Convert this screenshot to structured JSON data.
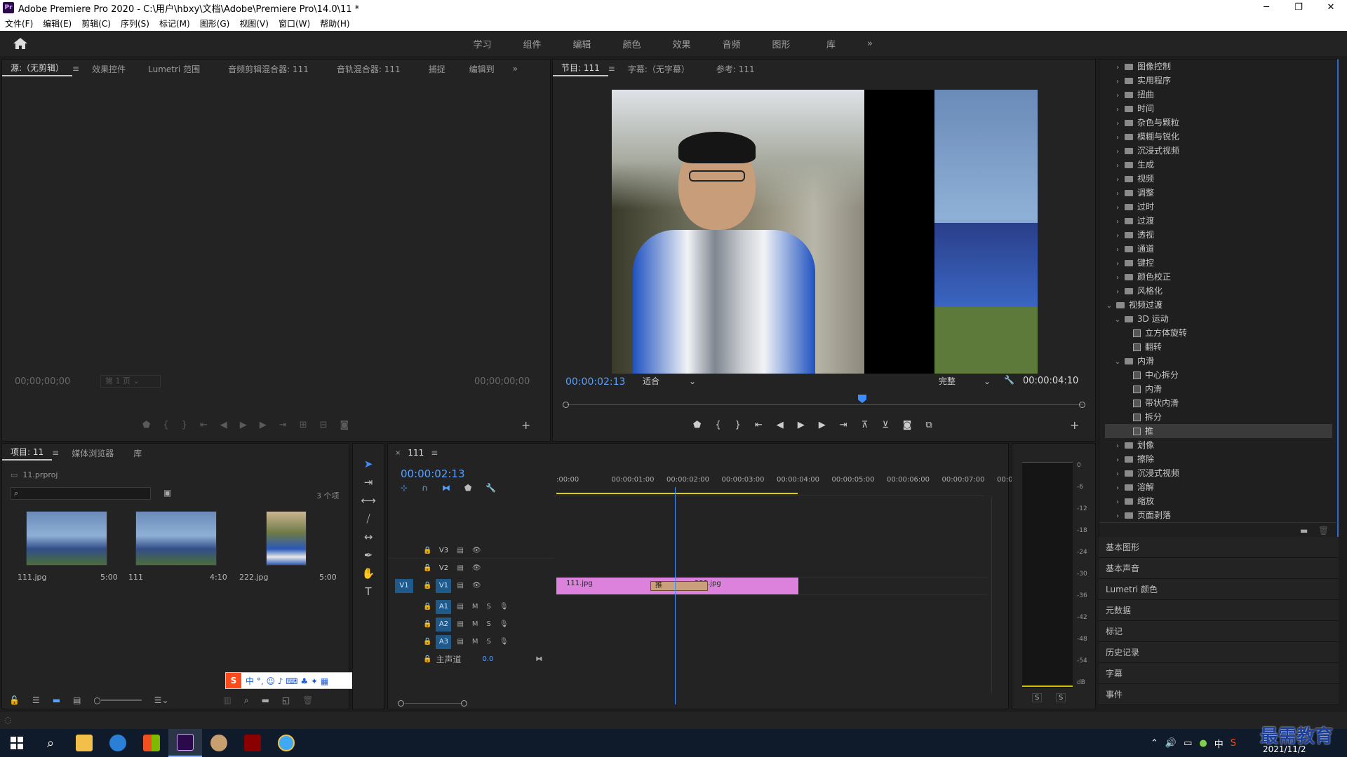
{
  "window": {
    "title": "Adobe Premiere Pro 2020 - C:\\用户\\hbxy\\文档\\Adobe\\Premiere Pro\\14.0\\11 *",
    "app_badge": "Pr"
  },
  "menu": [
    "文件(F)",
    "编辑(E)",
    "剪辑(C)",
    "序列(S)",
    "标记(M)",
    "图形(G)",
    "视图(V)",
    "窗口(W)",
    "帮助(H)"
  ],
  "workspaces": [
    "学习",
    "组件",
    "编辑",
    "颜色",
    "效果",
    "音频",
    "图形",
    "库"
  ],
  "source_panel": {
    "tabs": [
      "源:（无剪辑）",
      "效果控件",
      "Lumetri 范围",
      "音频剪辑混合器: 111",
      "音轨混合器: 111",
      "捕捉",
      "编辑到"
    ],
    "tc_in": "00;00;00;00",
    "tc_out": "00;00;00;00",
    "page_select": "第 1 页"
  },
  "program_panel": {
    "tabs": [
      "节目: 111",
      "字幕:（无字幕）",
      "参考: 111"
    ],
    "timecode": "00:00:02:13",
    "fit": "适合",
    "quality": "完整",
    "duration": "00:00:04:10"
  },
  "effects_tree": [
    {
      "type": "folder",
      "indent": 1,
      "label": "图像控制",
      "open": false
    },
    {
      "type": "folder",
      "indent": 1,
      "label": "实用程序",
      "open": false
    },
    {
      "type": "folder",
      "indent": 1,
      "label": "扭曲",
      "open": false
    },
    {
      "type": "folder",
      "indent": 1,
      "label": "时间",
      "open": false
    },
    {
      "type": "folder",
      "indent": 1,
      "label": "杂色与颗粒",
      "open": false
    },
    {
      "type": "folder",
      "indent": 1,
      "label": "模糊与锐化",
      "open": false
    },
    {
      "type": "folder",
      "indent": 1,
      "label": "沉浸式视频",
      "open": false
    },
    {
      "type": "folder",
      "indent": 1,
      "label": "生成",
      "open": false
    },
    {
      "type": "folder",
      "indent": 1,
      "label": "视频",
      "open": false
    },
    {
      "type": "folder",
      "indent": 1,
      "label": "调整",
      "open": false
    },
    {
      "type": "folder",
      "indent": 1,
      "label": "过时",
      "open": false
    },
    {
      "type": "folder",
      "indent": 1,
      "label": "过渡",
      "open": false
    },
    {
      "type": "folder",
      "indent": 1,
      "label": "透视",
      "open": false
    },
    {
      "type": "folder",
      "indent": 1,
      "label": "通道",
      "open": false
    },
    {
      "type": "folder",
      "indent": 1,
      "label": "键控",
      "open": false
    },
    {
      "type": "folder",
      "indent": 1,
      "label": "颜色校正",
      "open": false
    },
    {
      "type": "folder",
      "indent": 1,
      "label": "风格化",
      "open": false
    },
    {
      "type": "folder",
      "indent": 0,
      "label": "视频过渡",
      "open": true
    },
    {
      "type": "folder",
      "indent": 1,
      "label": "3D 运动",
      "open": true
    },
    {
      "type": "item",
      "indent": 2,
      "label": "立方体旋转"
    },
    {
      "type": "item",
      "indent": 2,
      "label": "翻转"
    },
    {
      "type": "folder",
      "indent": 1,
      "label": "内滑",
      "open": true
    },
    {
      "type": "item",
      "indent": 2,
      "label": "中心拆分"
    },
    {
      "type": "item",
      "indent": 2,
      "label": "内滑"
    },
    {
      "type": "item",
      "indent": 2,
      "label": "带状内滑"
    },
    {
      "type": "item",
      "indent": 2,
      "label": "拆分"
    },
    {
      "type": "item",
      "indent": 2,
      "label": "推",
      "selected": true
    },
    {
      "type": "folder",
      "indent": 1,
      "label": "划像",
      "open": false
    },
    {
      "type": "folder",
      "indent": 1,
      "label": "擦除",
      "open": false
    },
    {
      "type": "folder",
      "indent": 1,
      "label": "沉浸式视频",
      "open": false
    },
    {
      "type": "folder",
      "indent": 1,
      "label": "溶解",
      "open": false
    },
    {
      "type": "folder",
      "indent": 1,
      "label": "缩放",
      "open": false
    },
    {
      "type": "folder",
      "indent": 1,
      "label": "页面剥落",
      "open": false
    }
  ],
  "side_panels": [
    "基本图形",
    "基本声音",
    "Lumetri 颜色",
    "元数据",
    "标记",
    "历史记录",
    "字幕",
    "事件"
  ],
  "project_panel": {
    "tabs": [
      "项目: 11",
      "媒体浏览器",
      "库"
    ],
    "file": "11.prproj",
    "count": "3 个项",
    "items": [
      {
        "name": "111.jpg",
        "dur": "5:00"
      },
      {
        "name": "111",
        "dur": "4:10"
      },
      {
        "name": "222.jpg",
        "dur": "5:00"
      }
    ]
  },
  "timeline": {
    "tab": "111",
    "timecode": "00:00:02:13",
    "ruler": [
      ":00:00",
      "00:00:01:00",
      "00:00:02:00",
      "00:00:03:00",
      "00:00:04:00",
      "00:00:05:00",
      "00:00:06:00",
      "00:00:07:00",
      "00:00:0"
    ],
    "video_tracks": [
      "V3",
      "V2",
      "V1"
    ],
    "audio_tracks": [
      "A1",
      "A2",
      "A3"
    ],
    "src_patch": "V1",
    "master": {
      "label": "主声道",
      "value": "0.0"
    },
    "clip1": "111.jpg",
    "clip2": "222.jpg",
    "transition": "推",
    "playhead_fraction": 0.572
  },
  "audio_meter": {
    "scale": [
      "0",
      "-6",
      "-12",
      "-18",
      "-24",
      "-30",
      "-36",
      "-42",
      "-48",
      "-54",
      "dB"
    ],
    "solo": [
      "S",
      "S"
    ]
  },
  "ime": {
    "text": "中 °, ☺ ♪ ⌨ ♣ ✦ ▦"
  },
  "watermark": "最需教育",
  "taskbar": {
    "date": "2021/11/2"
  }
}
